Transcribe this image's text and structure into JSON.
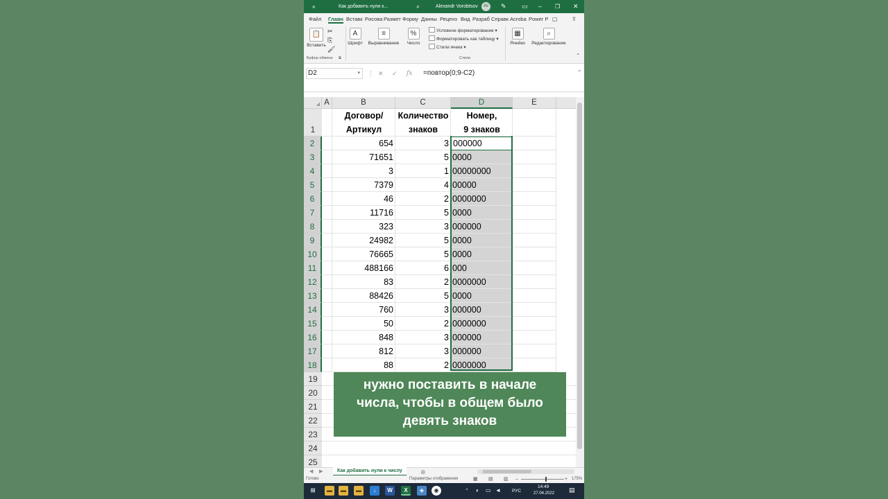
{
  "titlebar": {
    "doc_title": "Как добавить нули к...",
    "user": "Alexandr Vorobtsov",
    "initials": "AV"
  },
  "tabs": [
    "Файл",
    "Главн",
    "Вставк",
    "Рисова",
    "Размет",
    "Форму",
    "Данны",
    "Реценз",
    "Вид",
    "Разраб",
    "Справк",
    "Acroba",
    "Power P"
  ],
  "ribbon": {
    "paste": "Вставить",
    "font": "Шрифт",
    "align": "Выравнивание",
    "number": "Число",
    "cond_format": "Условное форматирование",
    "format_table": "Форматировать как таблицу",
    "cell_styles": "Стили ячеек",
    "cells": "Ячейки",
    "editing": "Редактирование",
    "clipboard_group": "Буфер обмена",
    "styles_group": "Стили"
  },
  "formula_bar": {
    "cell_ref": "D2",
    "formula": "=повтор(0;9-C2)"
  },
  "columns": [
    "A",
    "B",
    "C",
    "D",
    "E"
  ],
  "header": {
    "b1": "Договор/",
    "b2": "Артикул",
    "c1": "Количество",
    "c2": "знаков",
    "d1": "Номер,",
    "d2": "9 знаков"
  },
  "rows": [
    {
      "n": "2",
      "b": "654",
      "c": "3",
      "d": "000000"
    },
    {
      "n": "3",
      "b": "71651",
      "c": "5",
      "d": "0000"
    },
    {
      "n": "4",
      "b": "3",
      "c": "1",
      "d": "00000000"
    },
    {
      "n": "5",
      "b": "7379",
      "c": "4",
      "d": "00000"
    },
    {
      "n": "6",
      "b": "46",
      "c": "2",
      "d": "0000000"
    },
    {
      "n": "7",
      "b": "11716",
      "c": "5",
      "d": "0000"
    },
    {
      "n": "8",
      "b": "323",
      "c": "3",
      "d": "000000"
    },
    {
      "n": "9",
      "b": "24982",
      "c": "5",
      "d": "0000"
    },
    {
      "n": "10",
      "b": "76665",
      "c": "5",
      "d": "0000"
    },
    {
      "n": "11",
      "b": "488166",
      "c": "6",
      "d": "000"
    },
    {
      "n": "12",
      "b": "83",
      "c": "2",
      "d": "0000000"
    },
    {
      "n": "13",
      "b": "88426",
      "c": "5",
      "d": "0000"
    },
    {
      "n": "14",
      "b": "760",
      "c": "3",
      "d": "000000"
    },
    {
      "n": "15",
      "b": "50",
      "c": "2",
      "d": "0000000"
    },
    {
      "n": "16",
      "b": "848",
      "c": "3",
      "d": "000000"
    },
    {
      "n": "17",
      "b": "812",
      "c": "3",
      "d": "000000"
    },
    {
      "n": "18",
      "b": "88",
      "c": "2",
      "d": "0000000"
    }
  ],
  "empty_rows": [
    "1",
    "19",
    "20",
    "21",
    "22",
    "23",
    "24",
    "25"
  ],
  "caption": [
    "нужно поставить в начале",
    "числа, чтобы в общем было",
    "девять знаков"
  ],
  "sheet_tab": "Как добавить нули к числу",
  "status": {
    "ready": "Готово",
    "display_settings": "Параметры отображения",
    "zoom": "175%"
  },
  "taskbar": {
    "time": "14:49",
    "date": "27.04.2022",
    "lang": "РУС"
  },
  "colors": {
    "accent": "#1e6e41",
    "background": "#5c8663",
    "caption_bg": "#4f8758"
  }
}
